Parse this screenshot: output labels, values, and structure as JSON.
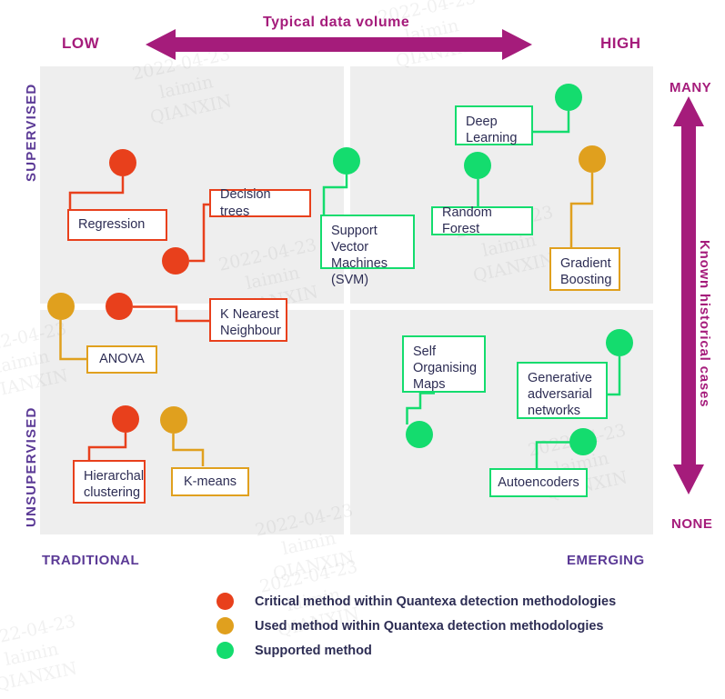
{
  "chart_data": {
    "type": "scatter",
    "title": "Typical data volume",
    "xlabel": "Typical data volume",
    "ylabel": "Known historical cases",
    "x_axis": {
      "arrow_label": "Typical data volume",
      "low_label": "LOW",
      "high_label": "HIGH",
      "bottom_left_label": "TRADITIONAL",
      "bottom_right_label": "EMERGING"
    },
    "y_axis": {
      "arrow_label": "Known historical cases",
      "top_label": "MANY",
      "bottom_label": "NONE",
      "upper_label": "SUPERVISED",
      "lower_label": "UNSUPERVISED"
    },
    "quadrants": [
      {
        "name": "supervised-traditional",
        "x_band": "LOW",
        "y_band": "MANY"
      },
      {
        "name": "supervised-emerging",
        "x_band": "HIGH",
        "y_band": "MANY"
      },
      {
        "name": "unsupervised-traditional",
        "x_band": "LOW",
        "y_band": "NONE"
      },
      {
        "name": "unsupervised-emerging",
        "x_band": "HIGH",
        "y_band": "NONE"
      }
    ],
    "categories": [
      "Critical method within Quantexa detection methodologies",
      "Used method within Quantexa detection methodologies",
      "Supported method"
    ],
    "points": [
      {
        "label": "Regression",
        "category": "critical",
        "color": "#e8401c",
        "quadrant": "supervised-traditional"
      },
      {
        "label": "Decision trees",
        "category": "critical",
        "color": "#e8401c",
        "quadrant": "supervised-traditional"
      },
      {
        "label": "Support Vector Machines (SVM)",
        "category": "supported",
        "color": "#14dc6e",
        "quadrant": "supervised-traditional"
      },
      {
        "label": "Deep Learning",
        "category": "supported",
        "color": "#14dc6e",
        "quadrant": "supervised-emerging"
      },
      {
        "label": "Random Forest",
        "category": "supported",
        "color": "#14dc6e",
        "quadrant": "supervised-emerging"
      },
      {
        "label": "Gradient Boosting",
        "category": "used",
        "color": "#e0a01e",
        "quadrant": "supervised-emerging"
      },
      {
        "label": "ANOVA",
        "category": "used",
        "color": "#e0a01e",
        "quadrant": "unsupervised-traditional"
      },
      {
        "label": "K Nearest Neighbour",
        "category": "critical",
        "color": "#e8401c",
        "quadrant": "unsupervised-traditional"
      },
      {
        "label": "Hierarchal clustering",
        "category": "critical",
        "color": "#e8401c",
        "quadrant": "unsupervised-traditional"
      },
      {
        "label": "K-means",
        "category": "used",
        "color": "#e0a01e",
        "quadrant": "unsupervised-traditional"
      },
      {
        "label": "Self Organising Maps",
        "category": "supported",
        "color": "#14dc6e",
        "quadrant": "unsupervised-emerging"
      },
      {
        "label": "Generative adversarial networks",
        "category": "supported",
        "color": "#14dc6e",
        "quadrant": "unsupervised-emerging"
      },
      {
        "label": "Autoencoders",
        "category": "supported",
        "color": "#14dc6e",
        "quadrant": "unsupervised-emerging"
      }
    ]
  },
  "colors": {
    "critical": "#e8401c",
    "used": "#e0a01e",
    "supported": "#14dc6e",
    "magenta": "#a51c7b",
    "purple": "#5b3a96",
    "box_text": "#2d2d54",
    "panel": "#eeeeee",
    "background": "#ffffff"
  },
  "axes": {
    "title": "Typical data volume",
    "low": "LOW",
    "high": "HIGH",
    "many": "MANY",
    "none": "NONE",
    "traditional": "TRADITIONAL",
    "emerging": "EMERGING",
    "supervised": "SUPERVISED",
    "unsupervised": "UNSUPERVISED",
    "known_cases": "Known historical cases"
  },
  "nodes": {
    "regression": "Regression",
    "decision_trees": "Decision trees",
    "svm": "Support Vector\nMachines\n(SVM)",
    "deep_learning": "Deep\nLearning",
    "random_forest": "Random Forest",
    "gradient_boosting": "Gradient\nBoosting",
    "anova": "ANOVA",
    "knn": "K Nearest\nNeighbour",
    "hierarchal_clustering": "Hierarchal\nclustering",
    "kmeans": "K-means",
    "self_organising_maps": "Self\nOrganising\nMaps",
    "gan": "Generative\nadversarial\nnetworks",
    "autoencoders": "Autoencoders"
  },
  "legend": {
    "items": [
      {
        "label": "Critical method within Quantexa detection methodologies",
        "color": "#e8401c"
      },
      {
        "label": "Used method within Quantexa detection methodologies",
        "color": "#e0a01e"
      },
      {
        "label": "Supported method",
        "color": "#14dc6e"
      }
    ]
  },
  "watermark": {
    "text": "2022-04-23\nlaimin\nQIANXIN"
  }
}
